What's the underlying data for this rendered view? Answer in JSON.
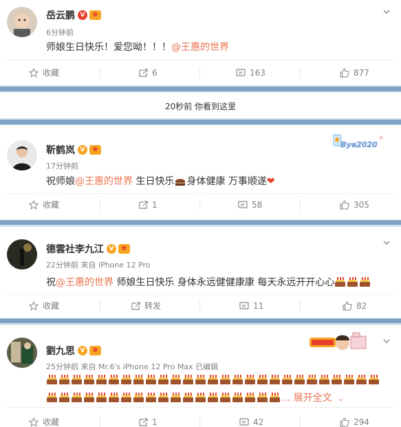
{
  "posts": [
    {
      "name": "岳云鹏",
      "time": "6分钟前",
      "source": "",
      "text_before": "师娘生日快乐！爱您呦！！！",
      "mention": "@王惠的世界",
      "text_after": "",
      "actions": {
        "fav": "收藏",
        "repost": "6",
        "comment": "163",
        "like": "877"
      }
    },
    {
      "name": "靳鹤岚",
      "time": "17分钟前",
      "source": "",
      "text_before": "祝师娘",
      "mention": "@王惠的世界",
      "text_after": " 生日快乐",
      "text_after2": "身体健康 万事顺遂",
      "actions": {
        "fav": "收藏",
        "repost": "1",
        "comment": "58",
        "like": "305"
      }
    },
    {
      "name": "德雲社李九江",
      "time": "22分钟前",
      "source": "来自 iPhone 12 Pro",
      "text_before": "祝",
      "mention": "@王惠的世界",
      "text_after": " 师娘生日快乐 身体永远健健康康 每天永远开开心心",
      "actions": {
        "fav": "收藏",
        "repost": "转发",
        "comment": "11",
        "like": "82"
      }
    },
    {
      "name": "劉九思",
      "time": "25分钟前",
      "source": "来自 Mr.6's iPhone 12 Pro Max",
      "edited": "已编辑",
      "more": "... 展开全文",
      "actions": {
        "fav": "收藏",
        "repost": "1",
        "comment": "42",
        "like": "294"
      }
    }
  ],
  "notice": "20秒前 你看到这里",
  "deco": {
    "bye2020": "Bye2020"
  },
  "colors": {
    "accent": "#eb7350",
    "gap": "#7fa3c6",
    "vgold": "#f6a623",
    "vred": "#e8412c"
  },
  "icons": [
    "star-icon",
    "repost-icon",
    "comment-icon",
    "like-icon",
    "chevron-down-icon"
  ]
}
